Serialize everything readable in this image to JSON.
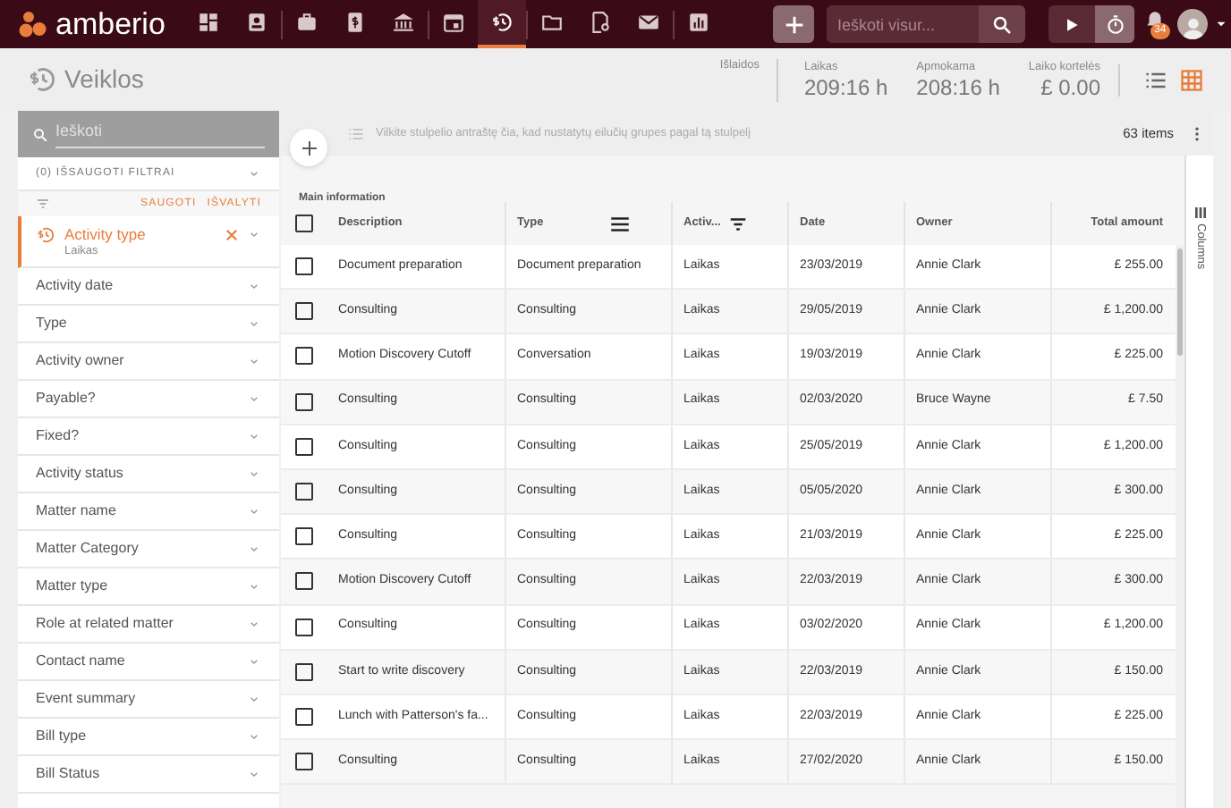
{
  "app": {
    "name": "amberio"
  },
  "nav": [
    {
      "kind": "dashboard",
      "selected": false
    },
    {
      "kind": "contacts",
      "selected": false
    },
    {
      "kind": "briefcase",
      "selected": false
    },
    {
      "kind": "invoice",
      "selected": false
    },
    {
      "kind": "bank",
      "selected": false
    },
    {
      "kind": "calendar",
      "selected": false
    },
    {
      "kind": "activities",
      "selected": true
    },
    {
      "kind": "folder",
      "selected": false
    },
    {
      "kind": "document",
      "selected": false
    },
    {
      "kind": "mail",
      "selected": false
    },
    {
      "kind": "reports",
      "selected": false
    }
  ],
  "global_search": {
    "placeholder": "Ieškoti visur..."
  },
  "notifications": {
    "count": "34"
  },
  "page": {
    "title": "Veiklos"
  },
  "stats": [
    {
      "label": "Išlaidos"
    },
    {
      "label": "Laikas",
      "value": "209:16 h"
    },
    {
      "label": "Apmokama",
      "value": "208:16 h"
    },
    {
      "label": "Laiko kortelės",
      "value": "£ 0.00"
    }
  ],
  "views": [
    {
      "kind": "list",
      "selected": false
    },
    {
      "kind": "grid",
      "selected": true
    }
  ],
  "sidebar": {
    "search_placeholder": "Ieškoti",
    "saved_filters": "(0) IŠSAUGOTI FILTRAI",
    "save": "SAUGOTI",
    "clear": "IŠVALYTI",
    "filters": [
      {
        "label": "Activity type",
        "value": "Laikas",
        "active": true
      },
      {
        "label": "Activity date",
        "active": false
      },
      {
        "label": "Type",
        "active": false
      },
      {
        "label": "Activity owner",
        "active": false
      },
      {
        "label": "Payable?",
        "active": false
      },
      {
        "label": "Fixed?",
        "active": false
      },
      {
        "label": "Activity status",
        "active": false
      },
      {
        "label": "Matter name",
        "active": false
      },
      {
        "label": "Matter Category",
        "active": false
      },
      {
        "label": "Matter type",
        "active": false
      },
      {
        "label": "Role at related matter",
        "active": false
      },
      {
        "label": "Contact name",
        "active": false
      },
      {
        "label": "Event summary",
        "active": false
      },
      {
        "label": "Bill type",
        "active": false
      },
      {
        "label": "Bill Status",
        "active": false
      }
    ]
  },
  "grid": {
    "group_hint": "Vilkite stulpelio antraštę čia, kad nustatytų eilučių grupes pagal tą stulpelį",
    "count": "63 items",
    "section": "Main information",
    "columns_tab": "Columns",
    "all_checked": false,
    "columns": [
      "Description",
      "Type",
      "Activ...",
      "Date",
      "Owner",
      "Total amount"
    ],
    "rows": [
      {
        "checked": false,
        "cells": [
          "Document preparation",
          "Document preparation",
          "Laikas",
          "23/03/2019",
          "Annie Clark",
          "£ 255.00"
        ]
      },
      {
        "checked": false,
        "cells": [
          "Consulting",
          "Consulting",
          "Laikas",
          "29/05/2019",
          "Annie Clark",
          "£ 1,200.00"
        ]
      },
      {
        "checked": false,
        "cells": [
          "Motion Discovery Cutoff",
          "Conversation",
          "Laikas",
          "19/03/2019",
          "Annie Clark",
          "£ 225.00"
        ]
      },
      {
        "checked": false,
        "cells": [
          "Consulting",
          "Consulting",
          "Laikas",
          "02/03/2020",
          "Bruce Wayne",
          "£ 7.50"
        ]
      },
      {
        "checked": false,
        "cells": [
          "Consulting",
          "Consulting",
          "Laikas",
          "25/05/2019",
          "Annie Clark",
          "£ 1,200.00"
        ]
      },
      {
        "checked": false,
        "cells": [
          "Consulting",
          "Consulting",
          "Laikas",
          "05/05/2020",
          "Annie Clark",
          "£ 300.00"
        ]
      },
      {
        "checked": false,
        "cells": [
          "Consulting",
          "Consulting",
          "Laikas",
          "21/03/2019",
          "Annie Clark",
          "£ 225.00"
        ]
      },
      {
        "checked": false,
        "cells": [
          "Motion Discovery Cutoff",
          "Consulting",
          "Laikas",
          "22/03/2019",
          "Annie Clark",
          "£ 300.00"
        ]
      },
      {
        "checked": false,
        "cells": [
          "Consulting",
          "Consulting",
          "Laikas",
          "03/02/2020",
          "Annie Clark",
          "£ 1,200.00"
        ]
      },
      {
        "checked": false,
        "cells": [
          "Start to write discovery",
          "Consulting",
          "Laikas",
          "22/03/2019",
          "Annie Clark",
          "£ 150.00"
        ]
      },
      {
        "checked": false,
        "cells": [
          "Lunch with Patterson's fa...",
          "Consulting",
          "Laikas",
          "22/03/2019",
          "Annie Clark",
          "£ 225.00"
        ]
      },
      {
        "checked": false,
        "cells": [
          "Consulting",
          "Consulting",
          "Laikas",
          "27/02/2020",
          "Annie Clark",
          "£ 150.00"
        ]
      }
    ]
  }
}
